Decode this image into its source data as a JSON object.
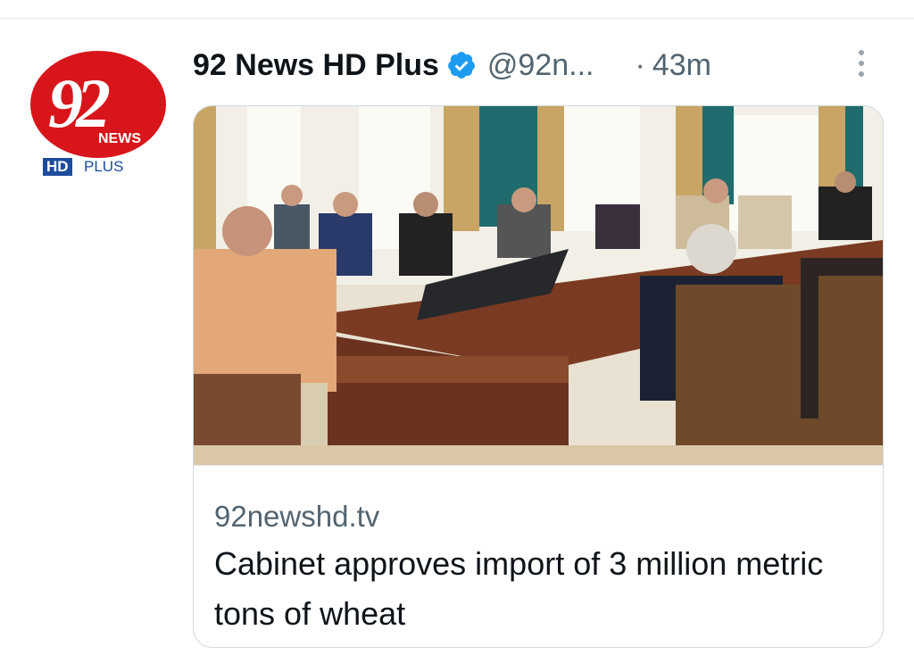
{
  "tweet": {
    "avatar": {
      "number": "92",
      "news": "NEWS",
      "hd": "HD",
      "plus": "PLUS"
    },
    "display_name": "92 News HD Plus",
    "handle": "@92n...",
    "separator": "·",
    "time": "43m"
  },
  "card": {
    "domain": "92newshd.tv",
    "headline": "Cabinet approves import of 3 million metric tons of wheat"
  },
  "colors": {
    "verified": "#1d9bf0",
    "brand_red": "#d8151b",
    "brand_blue": "#1d4c9c"
  }
}
